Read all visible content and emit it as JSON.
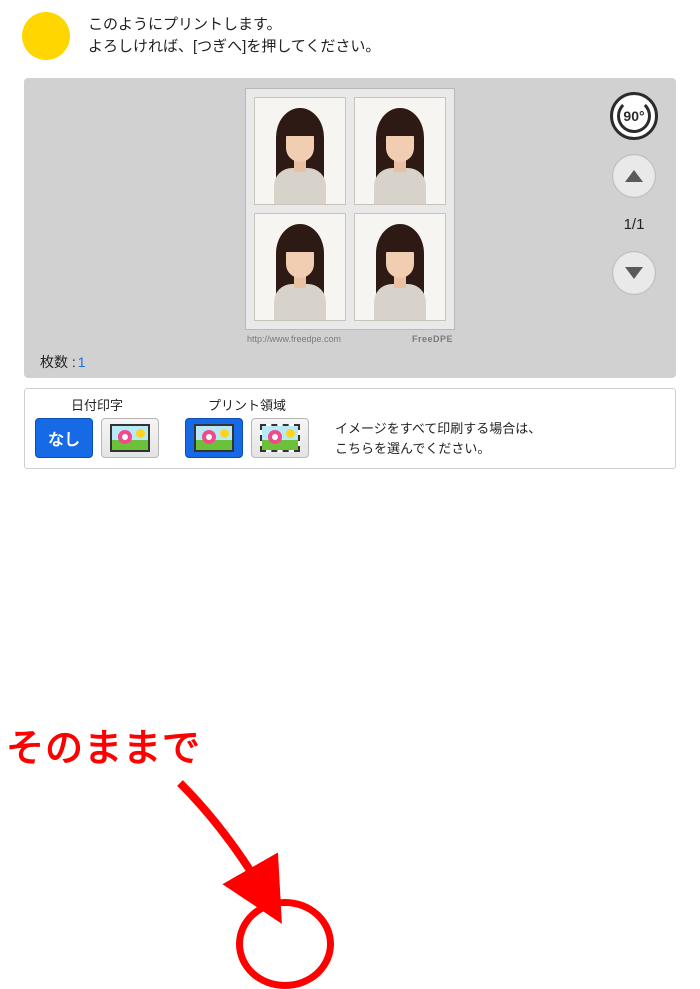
{
  "header": {
    "line1": "このようにプリントします。",
    "line2": "よろしければ、[つぎへ]を押してください。"
  },
  "preview": {
    "rotate_label": "90",
    "page_counter": "1/1",
    "footer_url": "http://www.freedpe.com",
    "footer_brand": "FreeDPE",
    "count_label": "枚数 :",
    "count_value": "1"
  },
  "options": {
    "date": {
      "title": "日付印字",
      "none_label": "なし"
    },
    "area": {
      "title": "プリント領域",
      "desc_line1": "イメージをすべて印刷する場合は、",
      "desc_line2": "こちらを選んでください。"
    }
  },
  "annotation": {
    "text": "そのままで"
  }
}
